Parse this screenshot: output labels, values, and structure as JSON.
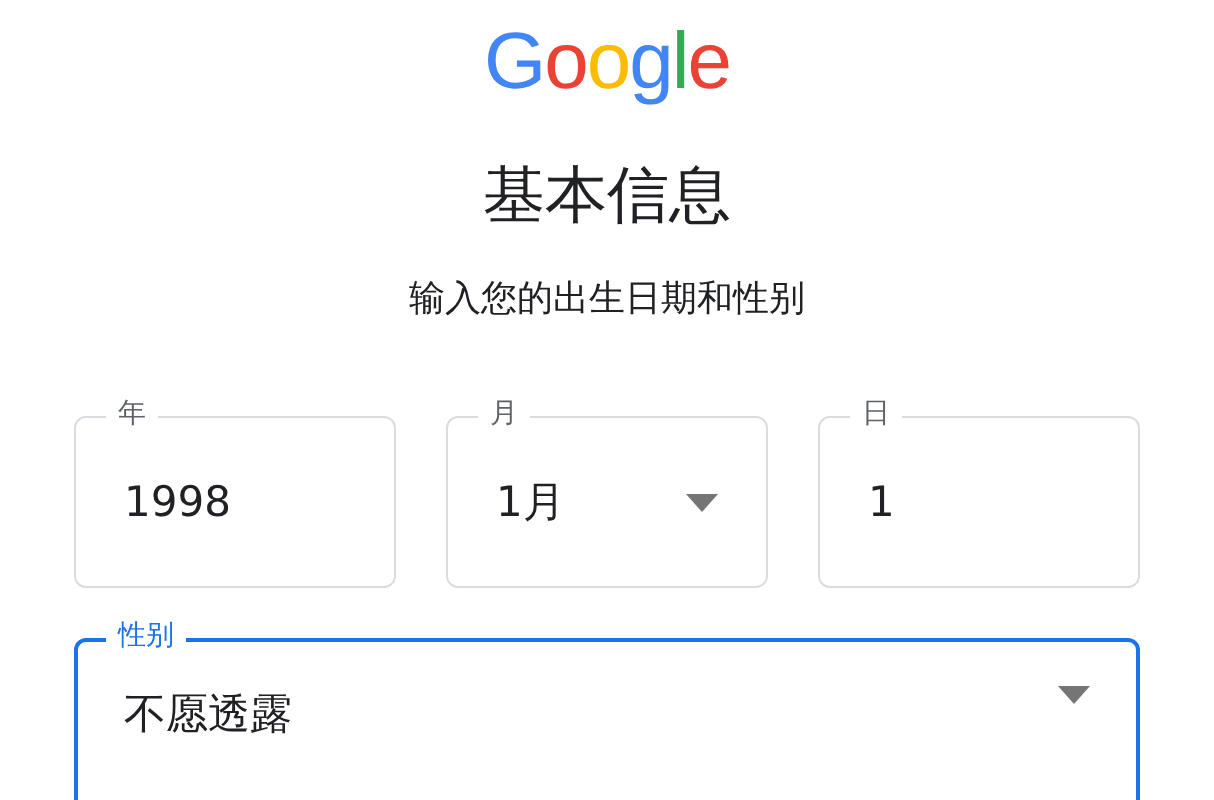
{
  "logo": "Google",
  "title": "基本信息",
  "subtitle": "输入您的出生日期和性别",
  "birth_fields": [
    {
      "label": "年",
      "value": "1998",
      "kind": "input",
      "focused": false
    },
    {
      "label": "月",
      "value": "1月",
      "kind": "select",
      "focused": false
    },
    {
      "label": "日",
      "value": "1",
      "kind": "input",
      "focused": false
    }
  ],
  "gender_field": {
    "label": "性别",
    "value": "不愿透露",
    "kind": "select",
    "focused": true
  }
}
